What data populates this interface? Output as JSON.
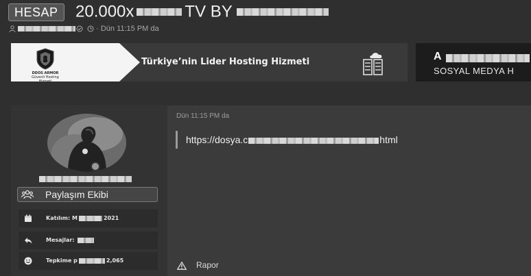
{
  "thread": {
    "prefix": "HESAP",
    "title_start": "20.000x",
    "title_middle": "TV BY",
    "posted_meta": "· Dün 11:15 PM da"
  },
  "ads": {
    "logo_caption": "DDOS ARMOR",
    "logo_subcaption": "Güvenli Hosting Hizmeti",
    "slogan": "Türkiye’nin Lider Hosting Hizmeti",
    "banner2_head": "A",
    "banner2_sub": "SOSYAL MEDYA H"
  },
  "user": {
    "role": "Paylaşım Ekibi",
    "joined_label": "Katılım:",
    "joined_prefix": "M",
    "joined_year": "2021",
    "messages_label": "Mesajlar:",
    "reactions_label": "Tepkime p",
    "reactions_value": "2,065"
  },
  "post": {
    "date": "Dün 11:15 PM da",
    "link_start": "https://dosya.c",
    "link_end": "html",
    "report": "Rapor"
  },
  "icons": {
    "user": "user-icon",
    "check": "check-circle-icon",
    "clock": "clock-icon",
    "shield": "shield-icon",
    "servers": "server-rack-icon",
    "team": "team-icon",
    "calendar": "calendar-icon",
    "reply": "reply-icon",
    "smile": "smile-icon",
    "warning": "warning-icon"
  },
  "colors": {
    "page_bg": "#2f2f2f",
    "panel_bg": "#333333",
    "post_bg": "#3b3b3b",
    "badge_bg": "#545454"
  }
}
